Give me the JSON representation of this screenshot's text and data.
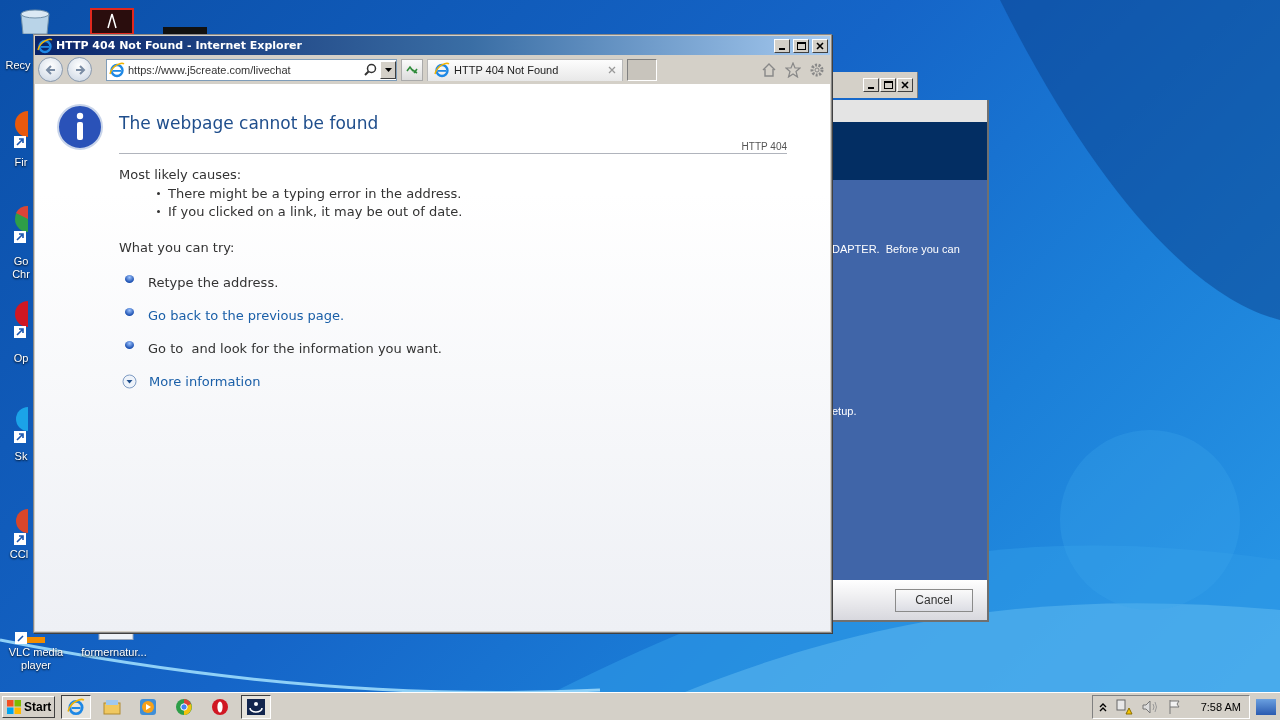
{
  "desktop": {
    "icons": [
      {
        "kind": "recycle",
        "label": "Recy"
      },
      {
        "kind": "pdf"
      },
      {
        "kind": "dark"
      },
      {
        "kind": "firefox",
        "label": "Fir"
      },
      {
        "kind": "chrome",
        "label": "Go Chr"
      },
      {
        "kind": "opera",
        "label": "Op"
      },
      {
        "kind": "skype",
        "label": "Sk"
      },
      {
        "kind": "ccleaner",
        "label": "CCl"
      },
      {
        "kind": "vlc",
        "label": "VLC media player"
      },
      {
        "kind": "file",
        "label": "formernatur..."
      }
    ]
  },
  "background_window": {
    "lines": [
      "DAPTER.  Before you can",
      "etup."
    ],
    "cancel_button": "Cancel"
  },
  "browser": {
    "title": "HTTP 404 Not Found - Internet Explorer",
    "address": "https://www.j5create.com/livechat",
    "tabs": [
      {
        "label": "HTTP 404 Not Found",
        "selected": true
      }
    ],
    "page": {
      "heading": "The webpage cannot be found",
      "code": "HTTP 404",
      "causes_title": "Most likely causes:",
      "causes": [
        "There might be a typing error in the address.",
        "If you clicked on a link, it may be out of date."
      ],
      "try_title": "What you can try:",
      "suggestions": [
        {
          "kind": "text",
          "text": "Retype the address."
        },
        {
          "kind": "link",
          "text": "Go back to the previous page."
        },
        {
          "kind": "text",
          "text": "Go to  and look for the information you want."
        }
      ],
      "more_info": "More information"
    }
  },
  "taskbar": {
    "start": "Start",
    "items": [
      {
        "kind": "ie",
        "selected": true
      },
      {
        "kind": "explorer",
        "selected": false
      },
      {
        "kind": "media",
        "selected": false
      },
      {
        "kind": "chrome",
        "selected": false
      },
      {
        "kind": "opera",
        "selected": false
      },
      {
        "kind": "setup",
        "selected": true
      }
    ],
    "clock": "7:58 AM"
  }
}
